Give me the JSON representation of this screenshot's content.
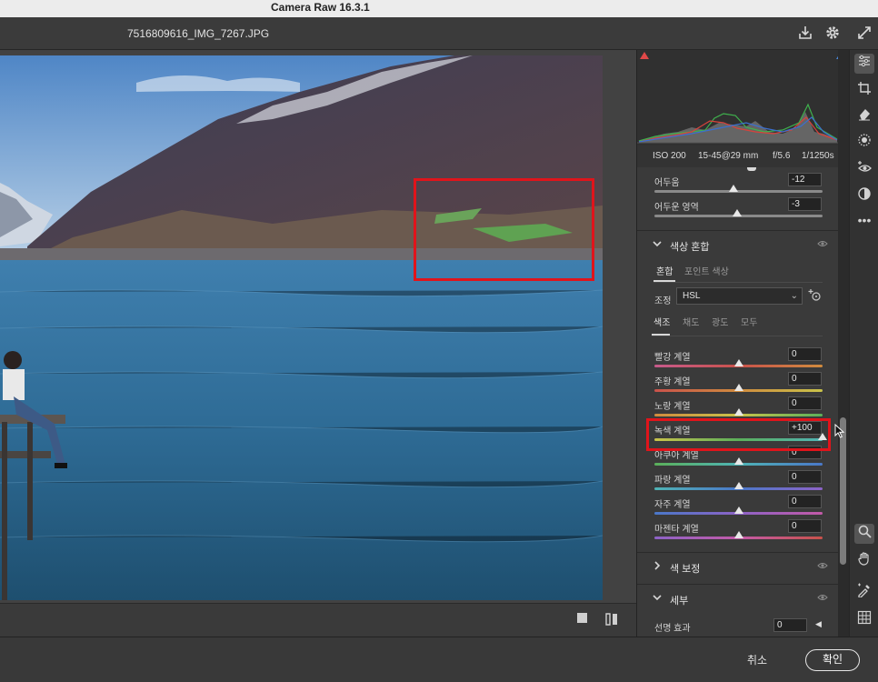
{
  "app": {
    "title": "Camera Raw 16.3.1"
  },
  "file": {
    "name": "7516809616_IMG_7267.JPG"
  },
  "header_icons": {
    "save": "download-icon",
    "settings": "gear-icon",
    "fullscreen": "expand-icon"
  },
  "camera_info": {
    "iso": "ISO 200",
    "lens": "15-45@29 mm",
    "aperture": "f/5.6",
    "shutter": "1/1250s"
  },
  "tone": {
    "sliders": [
      {
        "label": "어두움",
        "value": "-12",
        "position": 0.47
      },
      {
        "label": "어두운 영역",
        "value": "-3",
        "position": 0.49
      }
    ]
  },
  "color_mixer": {
    "title": "색상 혼합",
    "tabs": [
      "혼합",
      "포인트 색상"
    ],
    "adjust_label": "조정",
    "adjust_value": "HSL",
    "sub_tabs": [
      "색조",
      "채도",
      "광도",
      "모두"
    ],
    "sliders": [
      {
        "label": "빨강 계열",
        "value": "0",
        "position": 0.5
      },
      {
        "label": "주황 계열",
        "value": "0",
        "position": 0.5
      },
      {
        "label": "노랑 계열",
        "value": "0",
        "position": 0.5
      },
      {
        "label": "녹색 계열",
        "value": "+100",
        "position": 1.0
      },
      {
        "label": "아쿠아 계열",
        "value": "0",
        "position": 0.5
      },
      {
        "label": "파랑 계열",
        "value": "0",
        "position": 0.5
      },
      {
        "label": "자주 계열",
        "value": "0",
        "position": 0.5
      },
      {
        "label": "마젠타 계열",
        "value": "0",
        "position": 0.5
      }
    ]
  },
  "sections": {
    "color_grading": "색 보정",
    "detail": "세부"
  },
  "detail": {
    "sliders": [
      {
        "label": "선명 효과",
        "value": "0",
        "position": 0.0
      }
    ]
  },
  "tools": [
    "edit-sliders-icon",
    "crop-icon",
    "eraser-icon",
    "mask-icon",
    "red-eye-icon",
    "presets-icon",
    "more-icon",
    "zoom-icon",
    "hand-icon",
    "color-sampler-icon",
    "grid-icon"
  ],
  "footer": {
    "cancel": "취소",
    "ok": "확인"
  },
  "colors": {
    "red_highlight": "#e0141b",
    "track_red": "#c9524b",
    "track_orange": "#d08b3e",
    "track_yellow": "#c9c34a",
    "track_green": "#5bb05a",
    "track_aqua": "#4fb4b5",
    "track_blue": "#4a78c9",
    "track_purple": "#8d63c7",
    "track_magenta": "#c35aa8"
  }
}
